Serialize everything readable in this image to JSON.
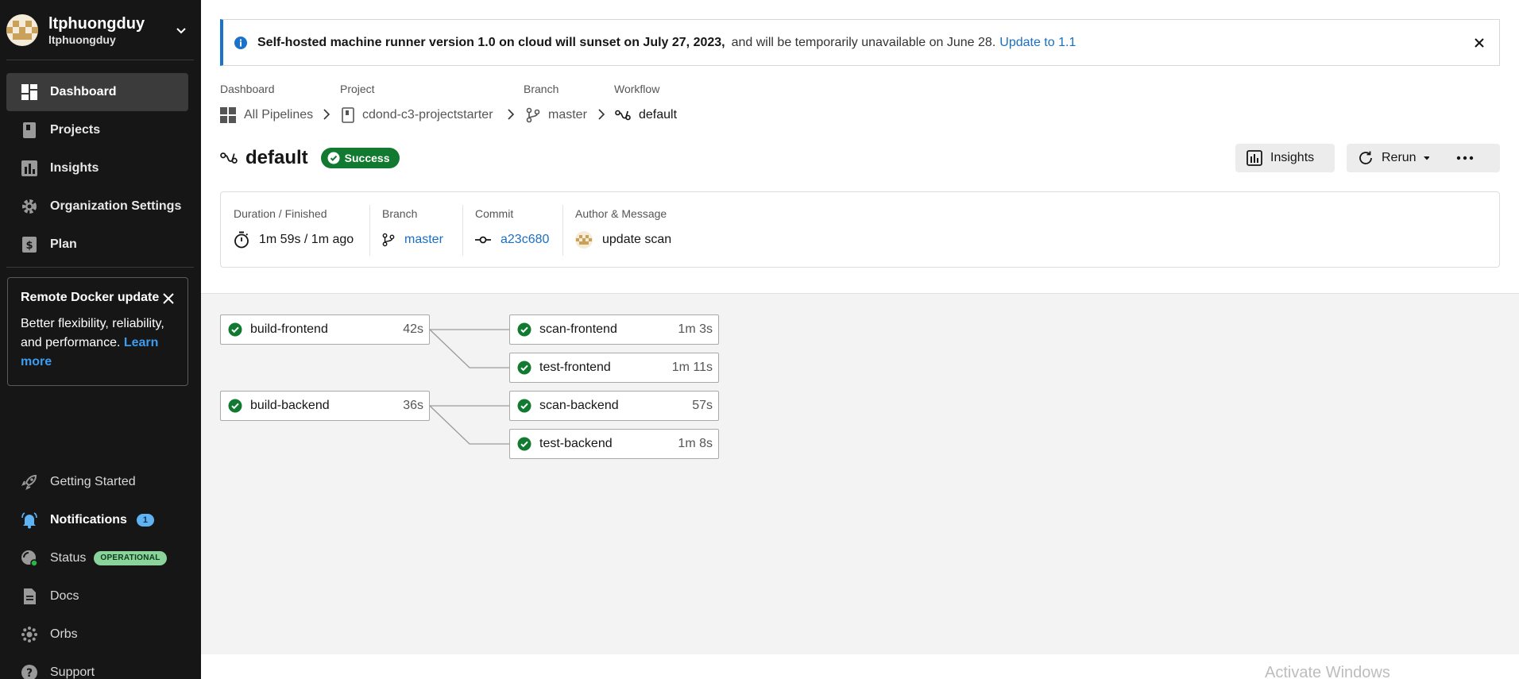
{
  "account": {
    "name": "ltphuongduy",
    "org": "ltphuongduy"
  },
  "nav": {
    "dashboard": "Dashboard",
    "projects": "Projects",
    "insights": "Insights",
    "org_settings": "Organization Settings",
    "plan": "Plan"
  },
  "promo": {
    "title": "Remote Docker update",
    "body": "Better flexibility, reliability, and performance.",
    "link": "Learn more"
  },
  "bottom_nav": {
    "getting_started": "Getting Started",
    "notifications": "Notifications",
    "notifications_count": "1",
    "status": "Status",
    "status_badge": "OPERATIONAL",
    "docs": "Docs",
    "orbs": "Orbs",
    "support": "Support"
  },
  "banner": {
    "bold": "Self-hosted machine runner version 1.0 on cloud will sunset on July 27, 2023,",
    "rest": "and will be temporarily unavailable on June 28.",
    "link": "Update to 1.1"
  },
  "breadcrumb": {
    "dashboard_label": "Dashboard",
    "dashboard_value": "All Pipelines",
    "project_label": "Project",
    "project_value": "cdond-c3-projectstarter",
    "branch_label": "Branch",
    "branch_value": "master",
    "workflow_label": "Workflow",
    "workflow_value": "default"
  },
  "workflow": {
    "title": "default",
    "status": "Success",
    "insights_btn": "Insights",
    "rerun_btn": "Rerun"
  },
  "summary": {
    "duration_label": "Duration / Finished",
    "duration_value": "1m 59s / 1m ago",
    "branch_label": "Branch",
    "branch_value": "master",
    "commit_label": "Commit",
    "commit_value": "a23c680",
    "author_label": "Author & Message",
    "author_value": "update scan"
  },
  "jobs": {
    "build_frontend": {
      "name": "build-frontend",
      "duration": "42s"
    },
    "build_backend": {
      "name": "build-backend",
      "duration": "36s"
    },
    "scan_frontend": {
      "name": "scan-frontend",
      "duration": "1m 3s"
    },
    "test_frontend": {
      "name": "test-frontend",
      "duration": "1m 11s"
    },
    "scan_backend": {
      "name": "scan-backend",
      "duration": "57s"
    },
    "test_backend": {
      "name": "test-backend",
      "duration": "1m 8s"
    }
  },
  "watermark": "Activate Windows",
  "colors": {
    "success": "#117a30",
    "link": "#1a6fc4",
    "sidebar": "#161616",
    "info": "#1a73c8"
  }
}
